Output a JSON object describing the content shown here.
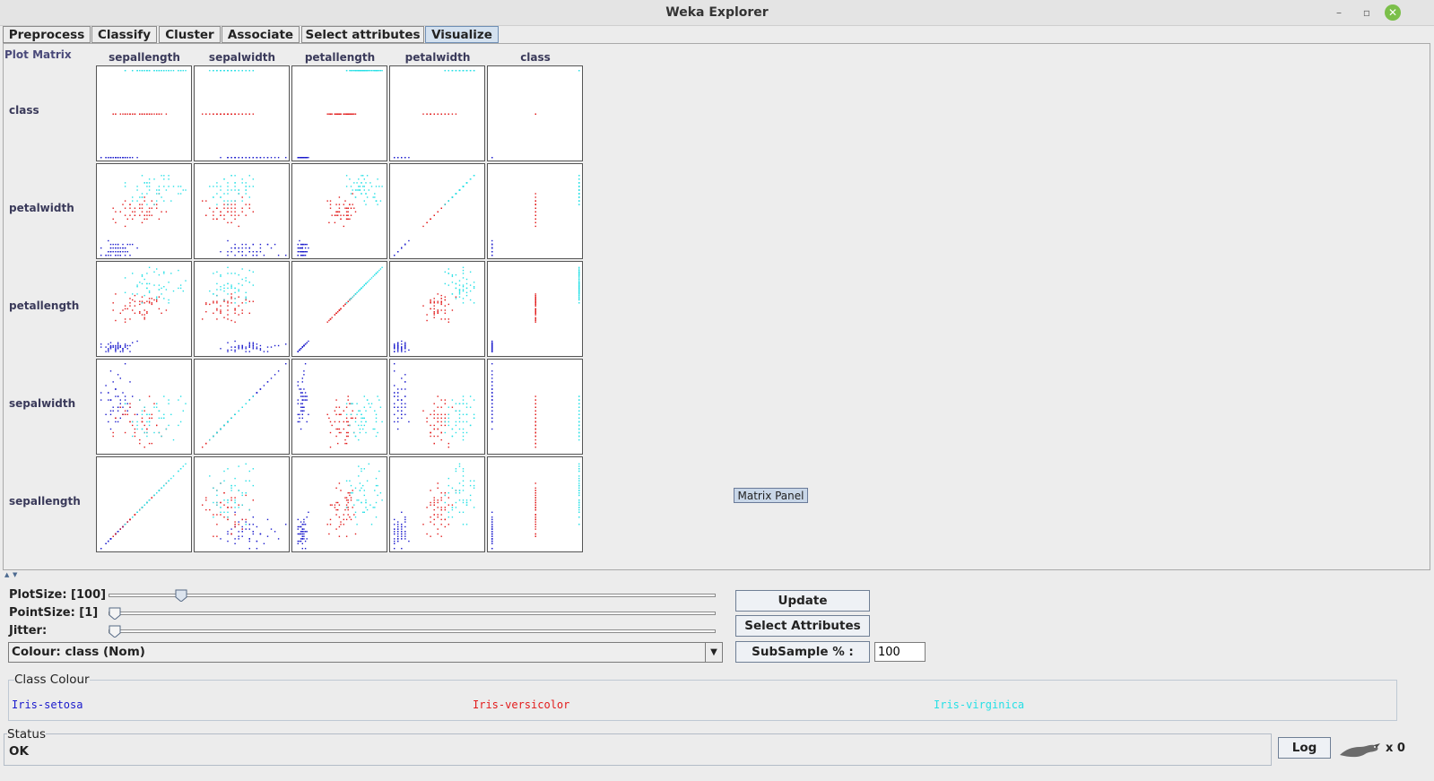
{
  "window": {
    "title": "Weka Explorer",
    "controls": [
      "minimize-icon",
      "maximize-icon",
      "close-icon"
    ],
    "control_glyphs": [
      "–",
      "▫",
      "✕"
    ]
  },
  "tabs": [
    {
      "label": "Preprocess",
      "active": false
    },
    {
      "label": "Classify",
      "active": false
    },
    {
      "label": "Cluster",
      "active": false
    },
    {
      "label": "Associate",
      "active": false
    },
    {
      "label": "Select attributes",
      "active": false
    },
    {
      "label": "Visualize",
      "active": true
    }
  ],
  "matrix": {
    "title": "Plot Matrix",
    "columns": [
      "sepallength",
      "sepalwidth",
      "petallength",
      "petalwidth",
      "class"
    ],
    "rows": [
      "class",
      "petalwidth",
      "petallength",
      "sepalwidth",
      "sepallength"
    ],
    "panel_button": "Matrix Panel"
  },
  "controls": {
    "plot_size_label": "PlotSize: [100]",
    "plot_size_level": 0.11,
    "point_size_label": "PointSize: [1]",
    "point_size_level": 0.0,
    "jitter_label": "Jitter:",
    "jitter_level": 0.0,
    "colour_select": "Colour: class (Nom)",
    "update_button": "Update",
    "select_attributes_button": "Select Attributes",
    "subsample_button": "SubSample % :",
    "subsample_value": "100"
  },
  "class_colour": {
    "title": "Class Colour",
    "items": [
      {
        "label": "Iris-setosa",
        "color": "#1a1acc"
      },
      {
        "label": "Iris-versicolor",
        "color": "#e21b1b"
      },
      {
        "label": "Iris-virginica",
        "color": "#26e0e6"
      }
    ]
  },
  "status": {
    "title": "Status",
    "text": "OK",
    "log_button": "Log",
    "task_count": "x 0"
  }
}
